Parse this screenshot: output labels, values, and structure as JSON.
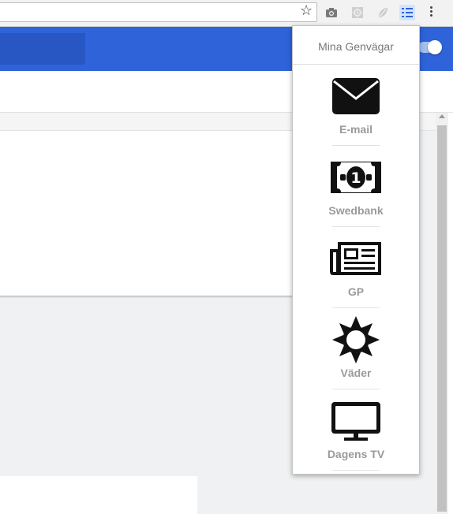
{
  "browser": {
    "bookmark_star": "☆"
  },
  "popup": {
    "title": "Mina Genvägar",
    "shortcuts": [
      {
        "label": "E-mail",
        "icon": "envelope-icon"
      },
      {
        "label": "Swedbank",
        "icon": "banknote-icon"
      },
      {
        "label": "GP",
        "icon": "newspaper-icon"
      },
      {
        "label": "Väder",
        "icon": "sun-icon"
      },
      {
        "label": "Dagens TV",
        "icon": "tv-icon"
      }
    ]
  },
  "colors": {
    "header_blue": "#2e63d9",
    "icon_black": "#111111",
    "label_gray": "#9a9a9a"
  }
}
